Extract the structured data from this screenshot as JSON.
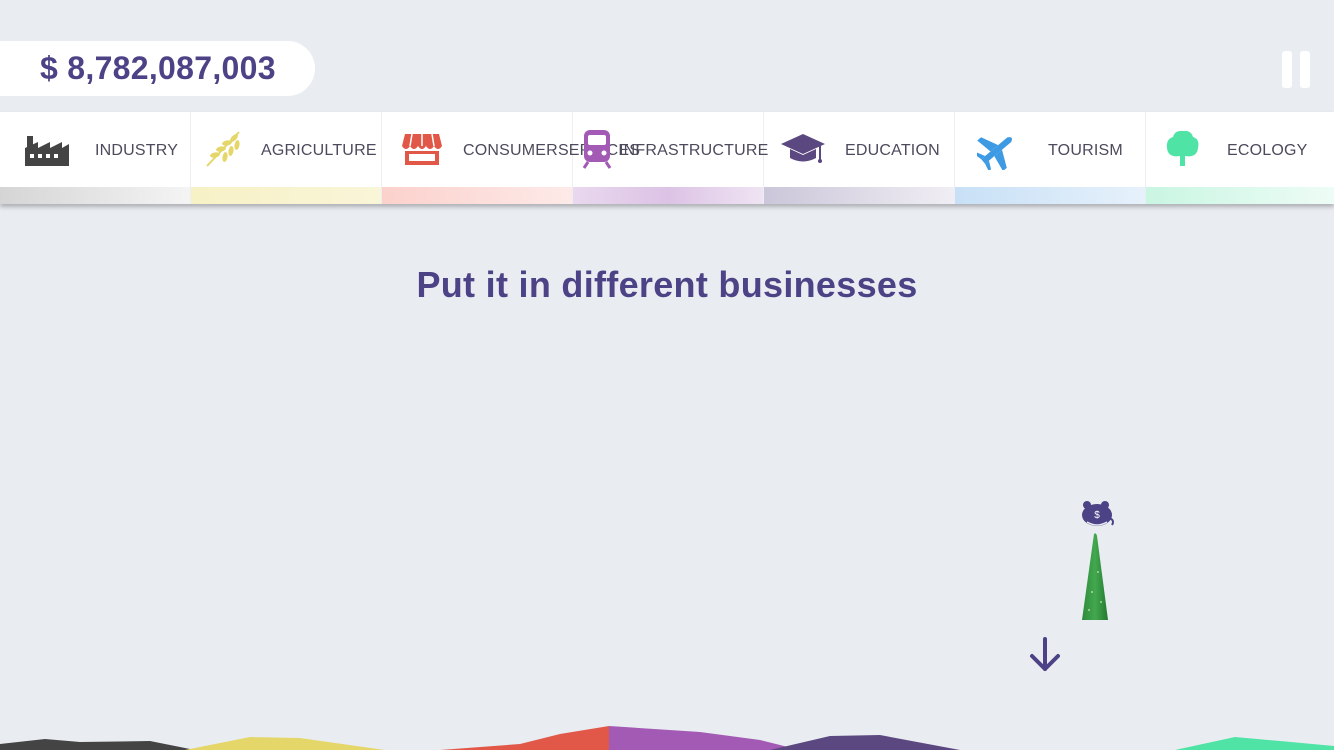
{
  "balance": {
    "text": "$ 8,782,087,003"
  },
  "colors": {
    "accent": "#4b4386",
    "industry": "#444444",
    "agriculture": "#e5d66a",
    "consumer_services": "#e25848",
    "infrastructure": "#a35ab5",
    "education": "#5b4880",
    "tourism": "#3d9ae3",
    "ecology": "#4fe3a6"
  },
  "categories": [
    {
      "id": "industry",
      "label": "INDUSTRY",
      "icon": "factory-icon",
      "color": "#444444",
      "strip": "#c9c9c9"
    },
    {
      "id": "agriculture",
      "label": "AGRICULTURE",
      "icon": "wheat-icon",
      "color": "#e5d66a",
      "strip": "#f5f0c4"
    },
    {
      "id": "consumer_services",
      "label_line1": "CONSUMER",
      "label_line2": "SERVICES",
      "icon": "storefront-icon",
      "color": "#e25848",
      "strip": "#fbd3cf"
    },
    {
      "id": "infrastructure",
      "label": "INFRASTRUCTURE",
      "icon": "train-icon",
      "color": "#a35ab5",
      "strip": "#e5d2ea"
    },
    {
      "id": "education",
      "label": "EDUCATION",
      "icon": "graduation-cap-icon",
      "color": "#5b4880",
      "strip": "#cfcadc"
    },
    {
      "id": "tourism",
      "label": "TOURISM",
      "icon": "airplane-icon",
      "color": "#3d9ae3",
      "strip": "#cbe2f6"
    },
    {
      "id": "ecology",
      "label": "ECOLOGY",
      "icon": "tree-icon",
      "color": "#4fe3a6",
      "strip": "#d2f8e7"
    }
  ],
  "hint": {
    "text": "Put it in different businesses"
  },
  "icons": {
    "pause": "pause-icon",
    "piggy_bank": "piggy-bank-icon",
    "down_arrow": "arrow-down-icon",
    "money_tower": "tree-tower-icon"
  }
}
